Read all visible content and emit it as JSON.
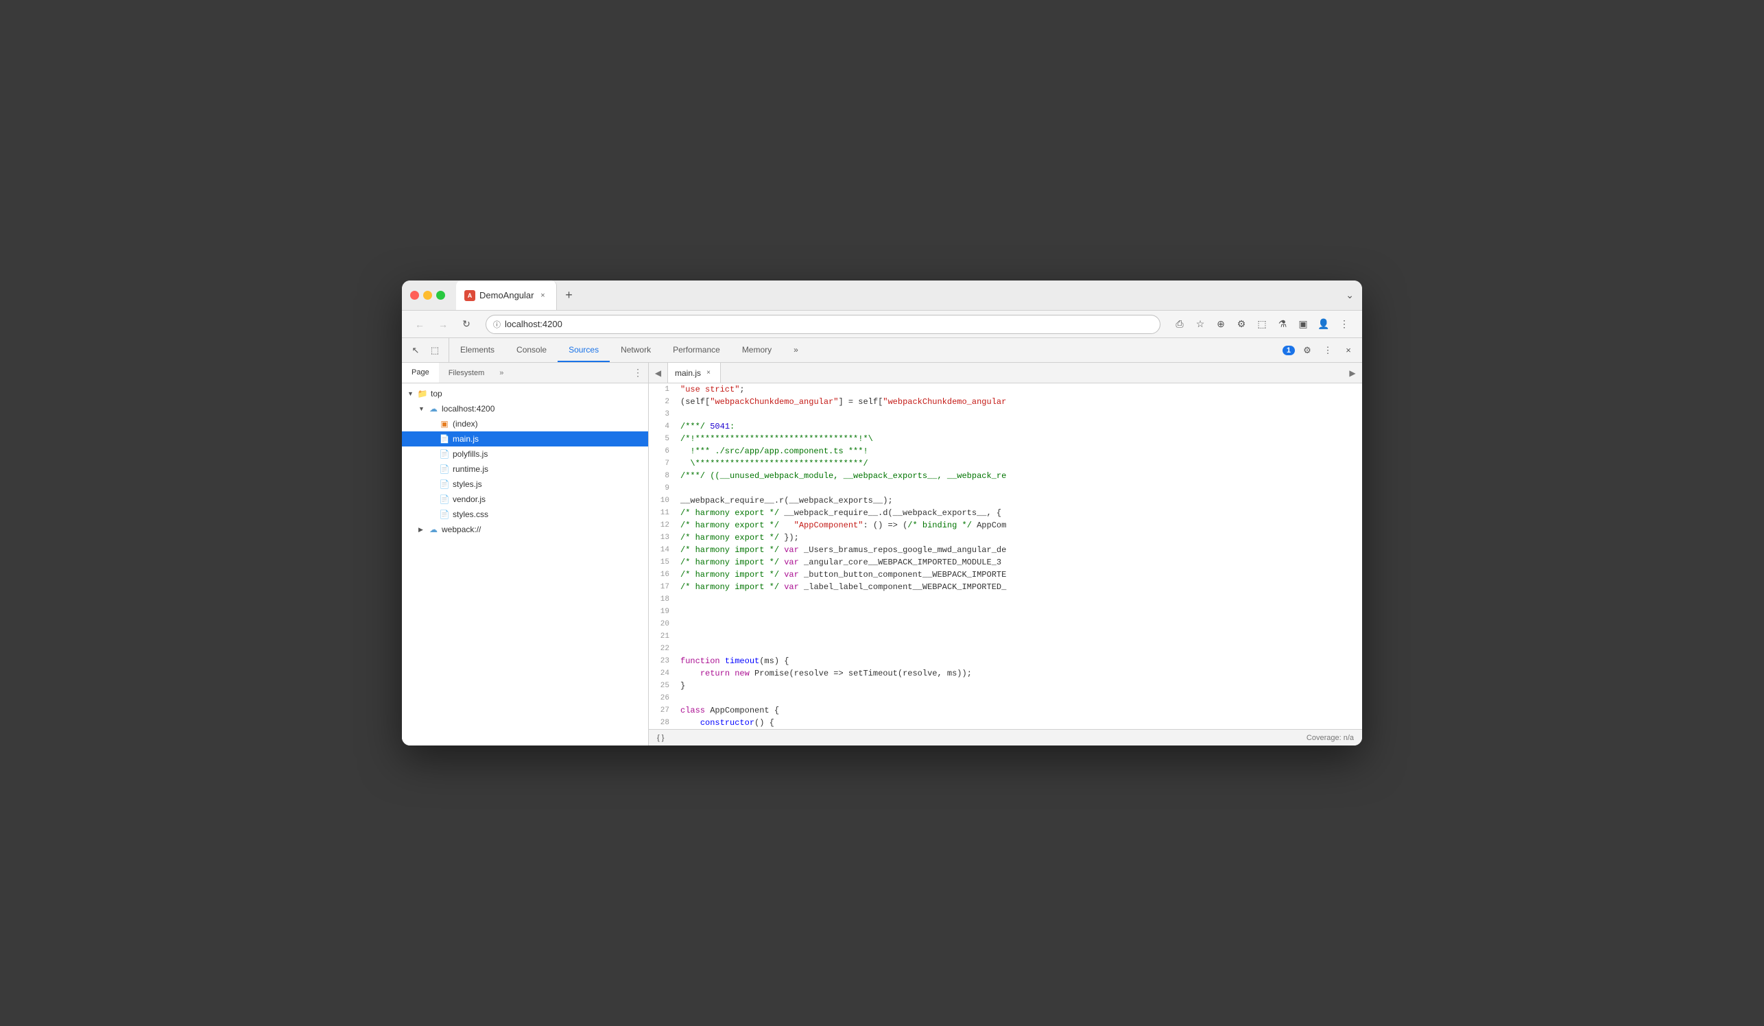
{
  "browser": {
    "tab_title": "DemoAngular",
    "tab_close_label": "×",
    "new_tab_label": "+",
    "address": "localhost:4200",
    "chevron_down": "⌄"
  },
  "nav": {
    "back_label": "←",
    "forward_label": "→",
    "reload_label": "↻",
    "address_text": "localhost:4200"
  },
  "devtools": {
    "tabs": [
      {
        "label": "Elements",
        "active": false
      },
      {
        "label": "Console",
        "active": false
      },
      {
        "label": "Sources",
        "active": true
      },
      {
        "label": "Network",
        "active": false
      },
      {
        "label": "Performance",
        "active": false
      },
      {
        "label": "Memory",
        "active": false
      }
    ],
    "more_tabs": "»",
    "badge_count": "1",
    "settings_label": "⚙",
    "more_options": "⋮",
    "close_label": "×"
  },
  "file_tree": {
    "tabs": [
      {
        "label": "Page",
        "active": true
      },
      {
        "label": "Filesystem",
        "active": false
      }
    ],
    "more": "»",
    "menu": "⋮",
    "items": [
      {
        "level": 0,
        "arrow": "▼",
        "icon": "folder",
        "label": "top",
        "selected": false
      },
      {
        "level": 1,
        "arrow": "▼",
        "icon": "folder-cloud",
        "label": "localhost:4200",
        "selected": false
      },
      {
        "level": 2,
        "arrow": "",
        "icon": "file-html",
        "label": "(index)",
        "selected": false
      },
      {
        "level": 2,
        "arrow": "",
        "icon": "file-js-yellow",
        "label": "main.js",
        "selected": true
      },
      {
        "level": 2,
        "arrow": "",
        "icon": "file-js-yellow",
        "label": "polyfills.js",
        "selected": false
      },
      {
        "level": 2,
        "arrow": "",
        "icon": "file-js-yellow",
        "label": "runtime.js",
        "selected": false
      },
      {
        "level": 2,
        "arrow": "",
        "icon": "file-js-yellow",
        "label": "styles.js",
        "selected": false
      },
      {
        "level": 2,
        "arrow": "",
        "icon": "file-js-yellow",
        "label": "vendor.js",
        "selected": false
      },
      {
        "level": 2,
        "arrow": "",
        "icon": "file-css",
        "label": "styles.css",
        "selected": false
      },
      {
        "level": 1,
        "arrow": "▶",
        "icon": "folder-cloud",
        "label": "webpack://",
        "selected": false
      }
    ]
  },
  "code_editor": {
    "tab_filename": "main.js",
    "tab_close": "×",
    "collapse_icon": "≫",
    "expand_icon": "≪",
    "lines": [
      {
        "num": 1,
        "content": "\"use strict\";",
        "tokens": [
          {
            "t": "string",
            "v": "\"use strict\";"
          }
        ]
      },
      {
        "num": 2,
        "content": "(self[\"webpackChunkdemo_angular\"] = self[\"webpackChunkdemo_angular"
      },
      {
        "num": 3,
        "content": ""
      },
      {
        "num": 4,
        "content": "/***/ 5041:",
        "tokens": [
          {
            "t": "comment",
            "v": "/***/ "
          },
          {
            "t": "number",
            "v": "5041"
          },
          {
            "t": "comment",
            "v": ":"
          }
        ]
      },
      {
        "num": 5,
        "content": "/*!*********************************!*\\",
        "tokens": [
          {
            "t": "comment",
            "v": "/*!*********************************!*\\"
          }
        ]
      },
      {
        "num": 6,
        "content": "  !*** ./src/app/app.component.ts ***!",
        "tokens": [
          {
            "t": "comment",
            "v": "  !*** ./src/app/app.component.ts ***!"
          }
        ]
      },
      {
        "num": 7,
        "content": "  \\**********************************/",
        "tokens": [
          {
            "t": "comment",
            "v": "  \\**********************************/"
          }
        ]
      },
      {
        "num": 8,
        "content": "/***/ ((__unused_webpack_module, __webpack_exports__, __webpack_re"
      },
      {
        "num": 9,
        "content": ""
      },
      {
        "num": 10,
        "content": "__webpack_require__.r(__webpack_exports__);"
      },
      {
        "num": 11,
        "content": "/* harmony export */ __webpack_require__.d(__webpack_exports__, {"
      },
      {
        "num": 12,
        "content": "/* harmony export */   \"AppComponent\": () => (/* binding */ AppCom"
      },
      {
        "num": 13,
        "content": "/* harmony export */ });"
      },
      {
        "num": 14,
        "content": "/* harmony import */ var _Users_bramus_repos_google_mwd_angular_de"
      },
      {
        "num": 15,
        "content": "/* harmony import */ var _angular_core__WEBPACK_IMPORTED_MODULE_3"
      },
      {
        "num": 16,
        "content": "/* harmony import */ var _button_button_component__WEBPACK_IMPORTE"
      },
      {
        "num": 17,
        "content": "/* harmony import */ var _label_label_component__WEBPACK_IMPORTED_"
      },
      {
        "num": 18,
        "content": ""
      },
      {
        "num": 19,
        "content": ""
      },
      {
        "num": 20,
        "content": ""
      },
      {
        "num": 21,
        "content": ""
      },
      {
        "num": 22,
        "content": ""
      },
      {
        "num": 23,
        "content": "function timeout(ms) {"
      },
      {
        "num": 24,
        "content": "    return new Promise(resolve => setTimeout(resolve, ms));"
      },
      {
        "num": 25,
        "content": "}"
      },
      {
        "num": 26,
        "content": ""
      },
      {
        "num": 27,
        "content": "class AppComponent {"
      },
      {
        "num": 28,
        "content": "    constructor() {"
      }
    ],
    "bottom_bar": {
      "braces_label": "{ }",
      "coverage_label": "Coverage: n/a"
    }
  }
}
